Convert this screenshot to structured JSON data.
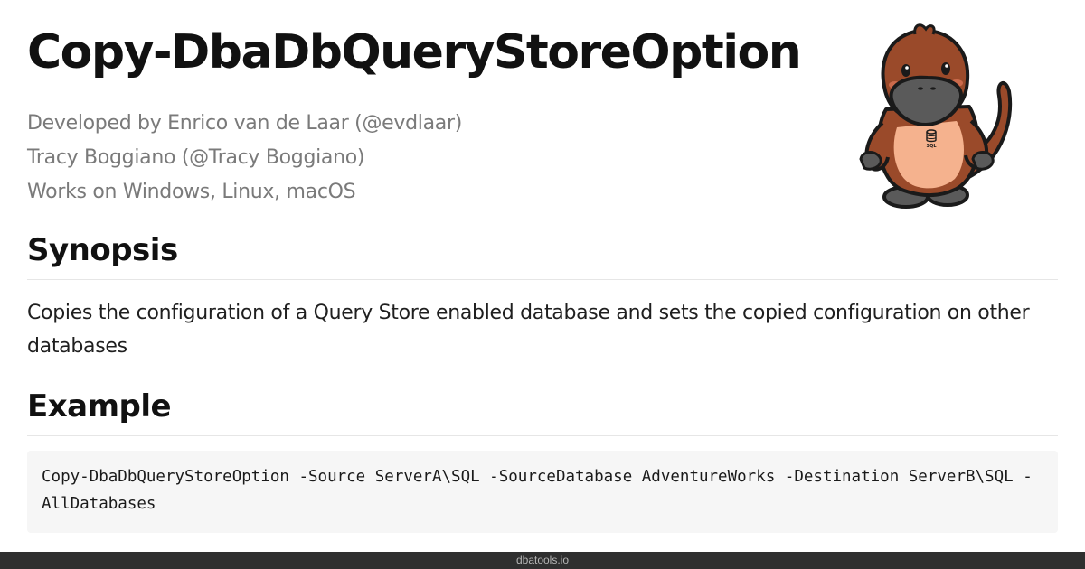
{
  "page": {
    "title": "Copy-DbaDbQueryStoreOption",
    "meta_lines": [
      "Developed by Enrico van de Laar (@evdlaar)",
      "Tracy Boggiano (@Tracy Boggiano)",
      "Works on Windows, Linux, macOS"
    ]
  },
  "mascot": {
    "badge_text": "SQL"
  },
  "synopsis": {
    "heading": "Synopsis",
    "text": "Copies the configuration of a Query Store enabled database and sets the copied configuration on other databases"
  },
  "example": {
    "heading": "Example",
    "code": "Copy-DbaDbQueryStoreOption -Source ServerA\\SQL -SourceDatabase AdventureWorks -Destination ServerB\\SQL -AllDatabases"
  },
  "footer": {
    "text": "dbatools.io"
  },
  "colors": {
    "text": "#111111",
    "muted": "#7a7a7a",
    "code_background": "#f6f6f6",
    "footer_background": "#2f2f2f",
    "mascot_body": "#9a4a2a",
    "mascot_belly": "#f5b28e",
    "mascot_bill": "#5a5a5a"
  }
}
